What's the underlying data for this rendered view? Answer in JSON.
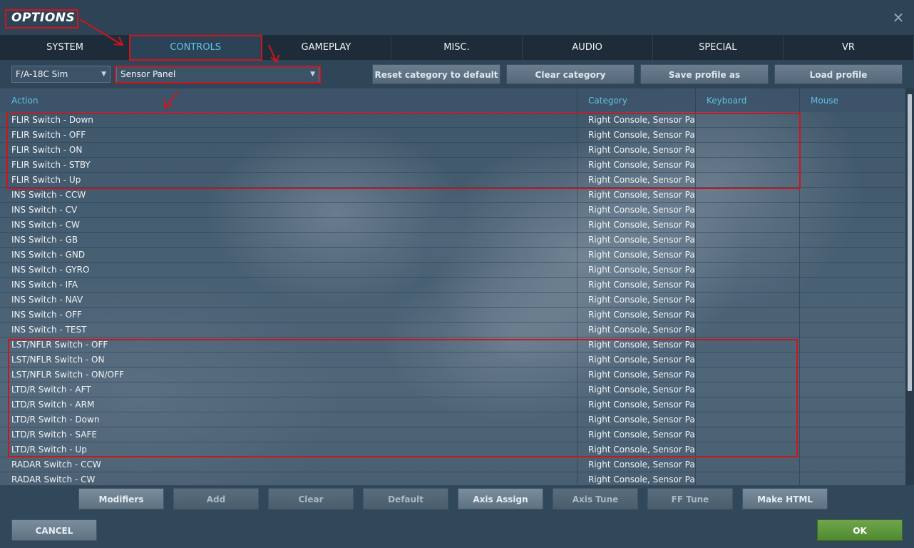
{
  "window": {
    "title": "OPTIONS",
    "close_glyph": "×",
    "close_icon": "close-icon"
  },
  "tabs": [
    {
      "label": "SYSTEM",
      "active": false
    },
    {
      "label": "CONTROLS",
      "active": true
    },
    {
      "label": "GAMEPLAY",
      "active": false
    },
    {
      "label": "MISC.",
      "active": false
    },
    {
      "label": "AUDIO",
      "active": false
    },
    {
      "label": "SPECIAL",
      "active": false
    },
    {
      "label": "VR",
      "active": false
    }
  ],
  "toolbar": {
    "aircraft_select": "F/A-18C Sim",
    "category_select": "Sensor Panel",
    "reset_category": "Reset category to default",
    "clear_category": "Clear category",
    "save_profile": "Save profile as",
    "load_profile": "Load profile"
  },
  "grid": {
    "headers": {
      "action": "Action",
      "category": "Category",
      "keyboard": "Keyboard",
      "mouse": "Mouse"
    },
    "rows": [
      {
        "action": "FLIR Switch - Down",
        "category": "Right Console, Sensor Pan"
      },
      {
        "action": "FLIR Switch - OFF",
        "category": "Right Console, Sensor Pan"
      },
      {
        "action": "FLIR Switch - ON",
        "category": "Right Console, Sensor Pan"
      },
      {
        "action": "FLIR Switch - STBY",
        "category": "Right Console, Sensor Pan"
      },
      {
        "action": "FLIR Switch - Up",
        "category": "Right Console, Sensor Pan"
      },
      {
        "action": "INS Switch - CCW",
        "category": "Right Console, Sensor Pan"
      },
      {
        "action": "INS Switch - CV",
        "category": "Right Console, Sensor Pan"
      },
      {
        "action": "INS Switch - CW",
        "category": "Right Console, Sensor Pan"
      },
      {
        "action": "INS Switch - GB",
        "category": "Right Console, Sensor Pan"
      },
      {
        "action": "INS Switch - GND",
        "category": "Right Console, Sensor Pan"
      },
      {
        "action": "INS Switch - GYRO",
        "category": "Right Console, Sensor Pan"
      },
      {
        "action": "INS Switch - IFA",
        "category": "Right Console, Sensor Pan"
      },
      {
        "action": "INS Switch - NAV",
        "category": "Right Console, Sensor Pan"
      },
      {
        "action": "INS Switch - OFF",
        "category": "Right Console, Sensor Pan"
      },
      {
        "action": "INS Switch - TEST",
        "category": "Right Console, Sensor Pan"
      },
      {
        "action": "LST/NFLR Switch - OFF",
        "category": "Right Console, Sensor Pan"
      },
      {
        "action": "LST/NFLR Switch - ON",
        "category": "Right Console, Sensor Pan"
      },
      {
        "action": "LST/NFLR Switch - ON/OFF",
        "category": "Right Console, Sensor Pan"
      },
      {
        "action": "LTD/R Switch - AFT",
        "category": "Right Console, Sensor Pan"
      },
      {
        "action": "LTD/R Switch - ARM",
        "category": "Right Console, Sensor Pan"
      },
      {
        "action": "LTD/R Switch - Down",
        "category": "Right Console, Sensor Pan"
      },
      {
        "action": "LTD/R Switch - SAFE",
        "category": "Right Console, Sensor Pan"
      },
      {
        "action": "LTD/R Switch - Up",
        "category": "Right Console, Sensor Pan"
      },
      {
        "action": "RADAR Switch - CCW",
        "category": "Right Console, Sensor Pan"
      },
      {
        "action": "RADAR Switch - CW",
        "category": "Right Console, Sensor Pan"
      }
    ]
  },
  "bottom": {
    "modifiers": "Modifiers",
    "add": "Add",
    "clear": "Clear",
    "default": "Default",
    "axis_assign": "Axis Assign",
    "axis_tune": "Axis Tune",
    "ff_tune": "FF Tune",
    "make_html": "Make HTML",
    "cancel": "CANCEL",
    "ok": "OK"
  },
  "colors": {
    "accent": "#62c6e6",
    "highlight": "#d0141c",
    "ok": "#5a9a3a"
  }
}
